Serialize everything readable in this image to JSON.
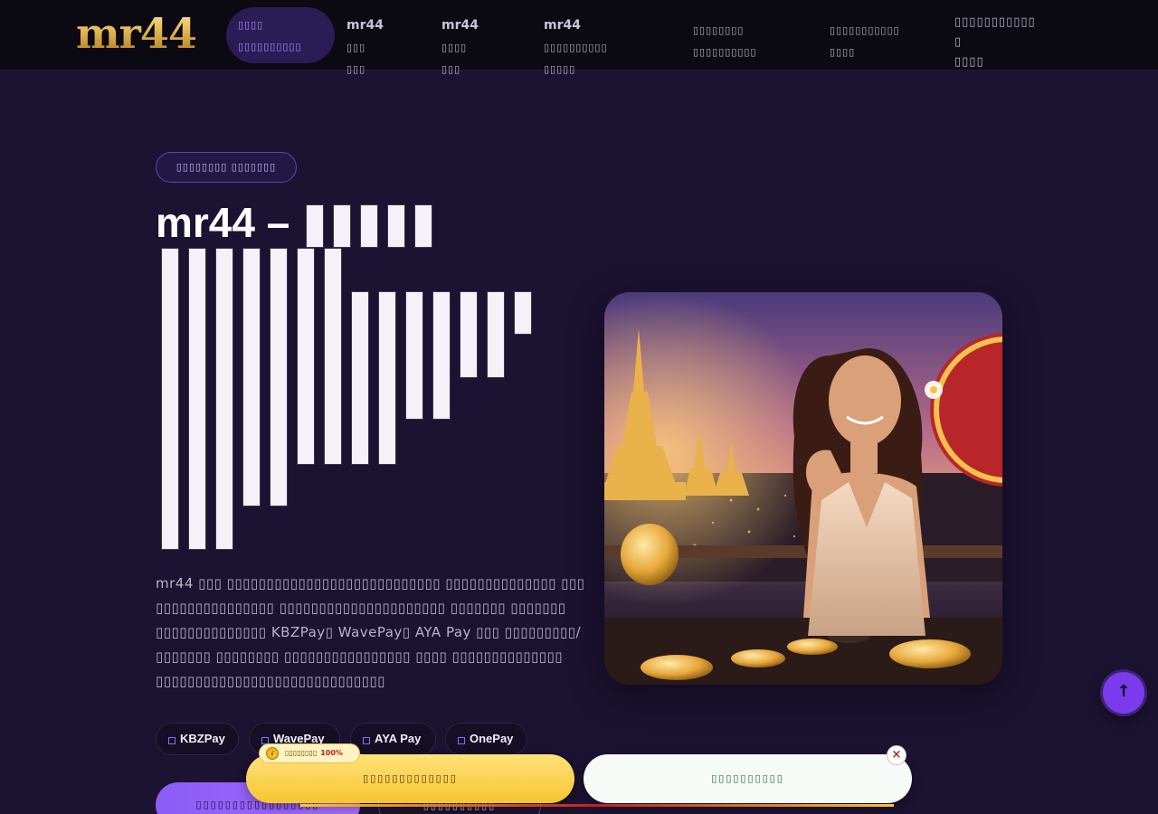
{
  "header": {
    "logo": "mr44",
    "nav": [
      {
        "line1": "▯▯▯▯",
        "line2": "▯▯▯▯▯▯▯▯▯▯"
      },
      {
        "prefix": "mr44",
        "line1": "▯▯▯",
        "line2": "▯▯▯"
      },
      {
        "prefix": "mr44",
        "line1": "▯▯▯▯",
        "line2": "▯▯▯"
      },
      {
        "prefix": "mr44",
        "line1": "▯▯▯▯▯▯▯▯▯▯",
        "line2": "▯▯▯▯▯"
      },
      {
        "line1": "▯▯▯▯▯▯▯▯",
        "line2": "▯▯▯▯▯▯▯▯▯▯"
      },
      {
        "line1": "▯▯▯▯▯▯▯▯▯▯▯",
        "line2": "▯▯▯▯"
      },
      {
        "line1": "▯▯▯▯▯▯▯▯▯▯▯ ▯",
        "line2": "▯▯▯▯"
      }
    ]
  },
  "hero": {
    "badge": "▯▯▯▯▯▯▯▯ ▯▯▯▯▯▯▯",
    "title": "mr44 –",
    "description": "mr44 ▯▯▯ ▯▯▯▯▯▯▯▯▯▯▯▯▯▯▯▯▯▯▯▯▯▯▯▯▯▯▯ ▯▯▯▯▯▯▯▯▯▯▯▯▯▯ ▯▯▯ ▯▯▯▯▯▯▯▯▯▯▯▯▯▯▯ ▯▯▯▯▯▯▯▯▯▯▯▯▯▯▯▯▯▯▯▯▯ ▯▯▯▯▯▯▯ ▯▯▯▯▯▯▯ ▯▯▯▯▯▯▯▯▯▯▯▯▯▯ KBZPay▯ WavePay▯ AYA Pay ▯▯▯ ▯▯▯▯▯▯▯▯▯/▯▯▯▯▯▯▯ ▯▯▯▯▯▯▯▯ ▯▯▯▯▯▯▯▯▯▯▯▯▯▯▯▯ ▯▯▯▯ ▯▯▯▯▯▯▯▯▯▯▯▯▯▯ ▯▯▯▯▯▯▯▯▯▯▯▯▯▯▯▯▯▯▯▯▯▯▯▯▯▯▯▯▯",
    "payments": [
      "KBZPay",
      "WavePay",
      "AYA Pay",
      "OnePay"
    ],
    "cta_primary": "▯▯▯▯▯▯▯▯▯▯▯▯▯▯▯▯▯",
    "cta_secondary": "▯▯▯▯▯▯▯▯▯▯"
  },
  "promo": {
    "tag": "▯▯▯▯▯▯▯▯",
    "tag_percent": "100%",
    "tag_icon": "💰",
    "deposit_label": "▯▯▯▯▯▯▯▯▯▯▯▯▯",
    "register_label": "▯▯▯▯▯▯▯▯▯▯",
    "close_icon": "×"
  },
  "to_top_icon": "↑",
  "colors": {
    "background": "#1c1232",
    "accent": "#7c3aed",
    "gold": "#f7c531"
  }
}
